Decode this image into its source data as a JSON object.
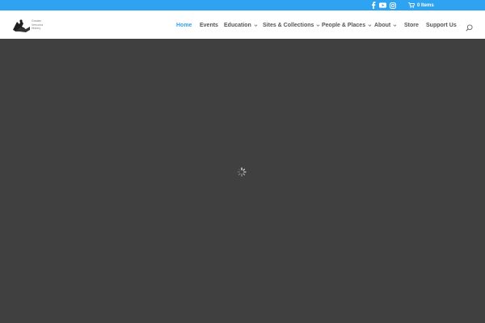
{
  "topbar": {
    "bg_color": "#2ea3f2",
    "social_icons": [
      "facebook-icon",
      "youtube-icon",
      "instagram-icon"
    ],
    "cart_label": "0 Items"
  },
  "header": {
    "logo_lines": [
      "Greater",
      "Vernonia",
      "History"
    ],
    "nav": [
      {
        "label": "Home",
        "active": true,
        "dropdown": false
      },
      {
        "label": "Events",
        "active": false,
        "dropdown": false
      },
      {
        "label": "Education",
        "active": false,
        "dropdown": true
      },
      {
        "label": "Sites & Collections",
        "active": false,
        "dropdown": true
      },
      {
        "label": "People & Places",
        "active": false,
        "dropdown": true
      },
      {
        "label": "About",
        "active": false,
        "dropdown": true
      },
      {
        "label": "Store",
        "active": false,
        "dropdown": false
      },
      {
        "label": "Support Us",
        "active": false,
        "dropdown": true
      }
    ],
    "accent_color": "#2ea3f2",
    "nav_color": "#555555"
  },
  "main": {
    "bg_color": "#404040",
    "loading_icon": "spinner-icon"
  }
}
